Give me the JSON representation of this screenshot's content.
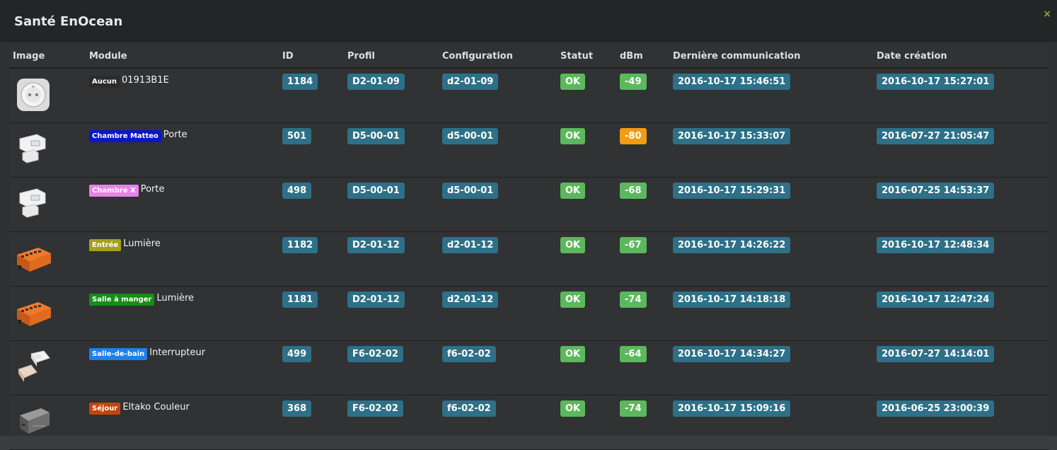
{
  "modal": {
    "title": "Santé EnOcean",
    "close_icon": "×"
  },
  "colors": {
    "tag_blue": "#2d7088",
    "tag_green": "#5cb85c",
    "tag_orange": "#f39c12",
    "close": "#7fae3f"
  },
  "columns": [
    "Image",
    "Module",
    "ID",
    "Profil",
    "Configuration",
    "Statut",
    "dBm",
    "Dernière communication",
    "Date création"
  ],
  "rows": [
    {
      "image": "wall-socket-plug",
      "object": "Aucun",
      "object_color": "#2b2b2b",
      "name": "01913B1E",
      "id": "1184",
      "profil": "D2-01-09",
      "config": "d2-01-09",
      "statut": "OK",
      "dbm": "-49",
      "dbm_level": "good",
      "last_comm": "2016-10-17 15:46:51",
      "created": "2016-10-17 15:27:01"
    },
    {
      "image": "door-contact-sensor",
      "object": "Chambre Matteo",
      "object_color": "#0a17c9",
      "name": "Porte",
      "id": "501",
      "profil": "D5-00-01",
      "config": "d5-00-01",
      "statut": "OK",
      "dbm": "-80",
      "dbm_level": "warning",
      "last_comm": "2016-10-17 15:33:07",
      "created": "2016-07-27 21:05:47"
    },
    {
      "image": "door-contact-sensor",
      "object": "Chambre X",
      "object_color": "#e982e6",
      "name": "Porte",
      "id": "498",
      "profil": "D5-00-01",
      "config": "d5-00-01",
      "statut": "OK",
      "dbm": "-68",
      "dbm_level": "good",
      "last_comm": "2016-10-17 15:29:31",
      "created": "2016-07-25 14:53:37"
    },
    {
      "image": "din-rail-actuator",
      "object": "Entrée",
      "object_color": "#a2a01e",
      "name": "Lumière",
      "id": "1182",
      "profil": "D2-01-12",
      "config": "d2-01-12",
      "statut": "OK",
      "dbm": "-67",
      "dbm_level": "good",
      "last_comm": "2016-10-17 14:26:22",
      "created": "2016-10-17 12:48:34"
    },
    {
      "image": "din-rail-actuator",
      "object": "Salle à manger",
      "object_color": "#178c17",
      "name": "Lumière",
      "id": "1181",
      "profil": "D2-01-12",
      "config": "d2-01-12",
      "statut": "OK",
      "dbm": "-74",
      "dbm_level": "good",
      "last_comm": "2016-10-17 14:18:18",
      "created": "2016-10-17 12:47:24"
    },
    {
      "image": "wall-switch",
      "object": "Salle-de-bain",
      "object_color": "#1e80e8",
      "name": "Interrupteur",
      "id": "499",
      "profil": "F6-02-02",
      "config": "f6-02-02",
      "statut": "OK",
      "dbm": "-64",
      "dbm_level": "good",
      "last_comm": "2016-10-17 14:34:27",
      "created": "2016-07-27 14:14:01"
    },
    {
      "image": "eltako-module",
      "object": "Séjour",
      "object_color": "#c3450d",
      "name": "Eltako Couleur",
      "id": "368",
      "profil": "F6-02-02",
      "config": "f6-02-02",
      "statut": "OK",
      "dbm": "-74",
      "dbm_level": "good",
      "last_comm": "2016-10-17 15:09:16",
      "created": "2016-06-25 23:00:39"
    }
  ]
}
